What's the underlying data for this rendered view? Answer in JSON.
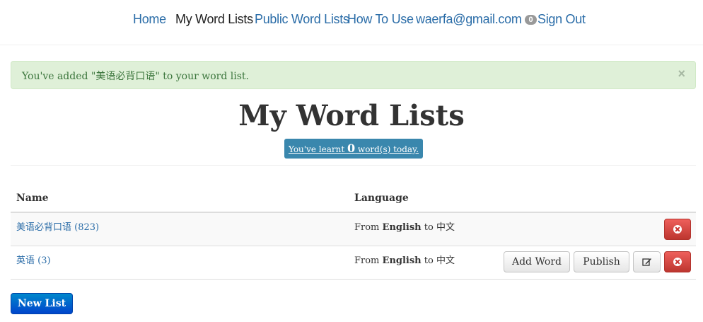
{
  "nav": {
    "items": [
      {
        "label": "Home"
      },
      {
        "label": "My Word Lists"
      },
      {
        "label": "Public Word Lists"
      },
      {
        "label": "How To Use"
      },
      {
        "label": "waerfa@gmail.com",
        "badge": "0"
      },
      {
        "label": "Sign Out"
      }
    ]
  },
  "alert": {
    "text": "You've added \"美语必背口语\" to your word list.",
    "close": "×"
  },
  "page": {
    "title": "My Word Lists",
    "learnt_prefix": "You've learnt ",
    "learnt_count": "0",
    "learnt_suffix": " word(s) today."
  },
  "table": {
    "headers": [
      "Name",
      "Language"
    ],
    "rows": [
      {
        "name": "美语必背口语 (823)",
        "lang_from": "From ",
        "lang_source": "English",
        "lang_to": " to ",
        "lang_target": "中文"
      },
      {
        "name": "英语 (3)",
        "lang_from": "From ",
        "lang_source": "English",
        "lang_to": " to ",
        "lang_target": "中文"
      }
    ],
    "actions": {
      "add_word": "Add Word",
      "publish": "Publish"
    }
  },
  "new_list": "New List",
  "colors": {
    "link": "#2b6da8",
    "alert_bg": "#dff0d8",
    "alert_text": "#3c763d",
    "info": "#3a87ad",
    "danger": "#d9534f",
    "primary": "#0066cc"
  },
  "icons": [
    "remove-circle-icon",
    "edit-icon",
    "close-icon"
  ]
}
